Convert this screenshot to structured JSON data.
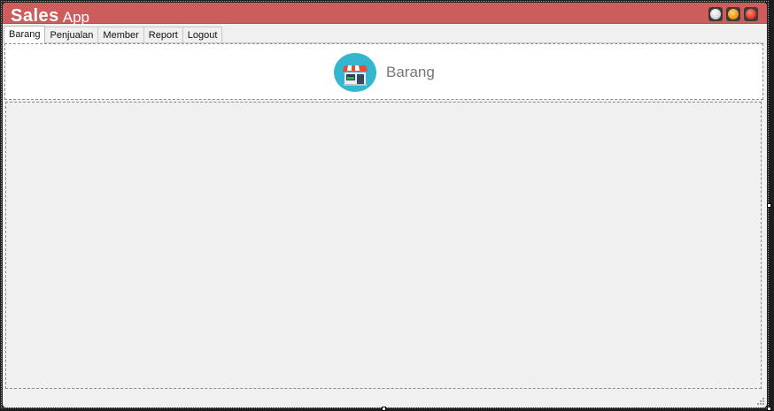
{
  "window": {
    "title_bold": "Sales",
    "title_light": "App_"
  },
  "controls": {
    "minimize_icon": "minimize-icon",
    "maximize_icon": "maximize-icon",
    "close_icon": "close-icon"
  },
  "tabs": [
    {
      "label": "Barang"
    },
    {
      "label": "Penjualan"
    },
    {
      "label": "Member"
    },
    {
      "label": "Report"
    },
    {
      "label": "Logout"
    }
  ],
  "active_tab": "Barang",
  "header": {
    "icon": "shop-icon",
    "title": "Barang"
  },
  "colors": {
    "titlebar": "#cd5c5c",
    "icon_circle": "#35b6cf"
  }
}
